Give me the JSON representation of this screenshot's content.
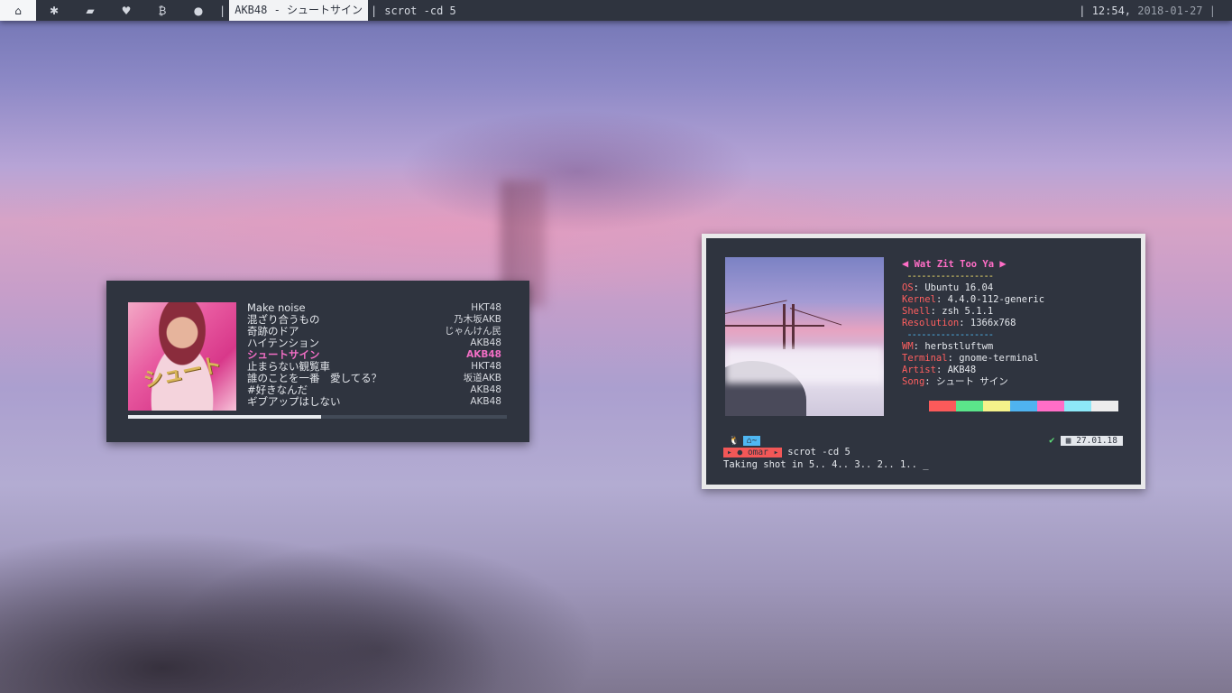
{
  "topbar": {
    "buttons": [
      {
        "icon": "home-icon",
        "glyph": "⌂"
      },
      {
        "icon": "gear-icon",
        "glyph": "✱"
      },
      {
        "icon": "folder-icon",
        "glyph": "▰"
      },
      {
        "icon": "heartbeat-icon",
        "glyph": "♥"
      },
      {
        "icon": "bitcoin-icon",
        "glyph": "₿"
      },
      {
        "icon": "github-icon",
        "glyph": "●"
      }
    ],
    "separator": "|",
    "active_window": "AKB48 - シュートサイン",
    "title": "scrot -cd 5",
    "clock_sep": "|",
    "time": "12:54,",
    "date": "2018-01-27",
    "clock_end": "|"
  },
  "music": {
    "cover_text": "シュート",
    "tracks": [
      {
        "title": "Make noise",
        "artist": "HKT48"
      },
      {
        "title": "混ざり合うもの",
        "artist": "乃木坂AKB"
      },
      {
        "title": "奇跡のドア",
        "artist": "じゃんけん民"
      },
      {
        "title": "ハイテンション",
        "artist": "AKB48"
      },
      {
        "title": "シュートサイン",
        "artist": "AKB48"
      },
      {
        "title": "止まらない観覧車",
        "artist": "HKT48"
      },
      {
        "title": "誰のことを一番　愛してる？",
        "artist": "坂道AKB"
      },
      {
        "title": "#好きなんだ",
        "artist": "AKB48"
      },
      {
        "title": "ギブアップはしない",
        "artist": "AKB48"
      }
    ],
    "current_index": 4,
    "progress": 0.51
  },
  "terminal": {
    "banner": "Wat Zit Too Ya",
    "dashes": "------------------",
    "fields_top": [
      {
        "key": "OS",
        "value": "Ubuntu 16.04"
      },
      {
        "key": "Kernel",
        "value": "4.4.0-112-generic"
      },
      {
        "key": "Shell",
        "value": "zsh 5.1.1"
      },
      {
        "key": "Resolution",
        "value": "1366x768"
      }
    ],
    "fields_bottom": [
      {
        "key": "WM",
        "value": "herbstluftwm"
      },
      {
        "key": "Terminal",
        "value": "gnome-terminal"
      },
      {
        "key": "Artist",
        "value": "AKB48"
      },
      {
        "key": "Song",
        "value": "シュート サイン"
      }
    ],
    "palette": [
      "#fc5a5a",
      "#5be58a",
      "#f5f28a",
      "#4fb3f0",
      "#ff6ec7",
      "#8de8f8",
      "#ededed"
    ],
    "prompt": {
      "os_glyph": "🐧",
      "dir": "~",
      "date": "27.01.18",
      "user": "omar",
      "command": "scrot -cd 5",
      "output": "Taking shot in 5.. 4.. 3.. 2.. 1.. _"
    }
  }
}
